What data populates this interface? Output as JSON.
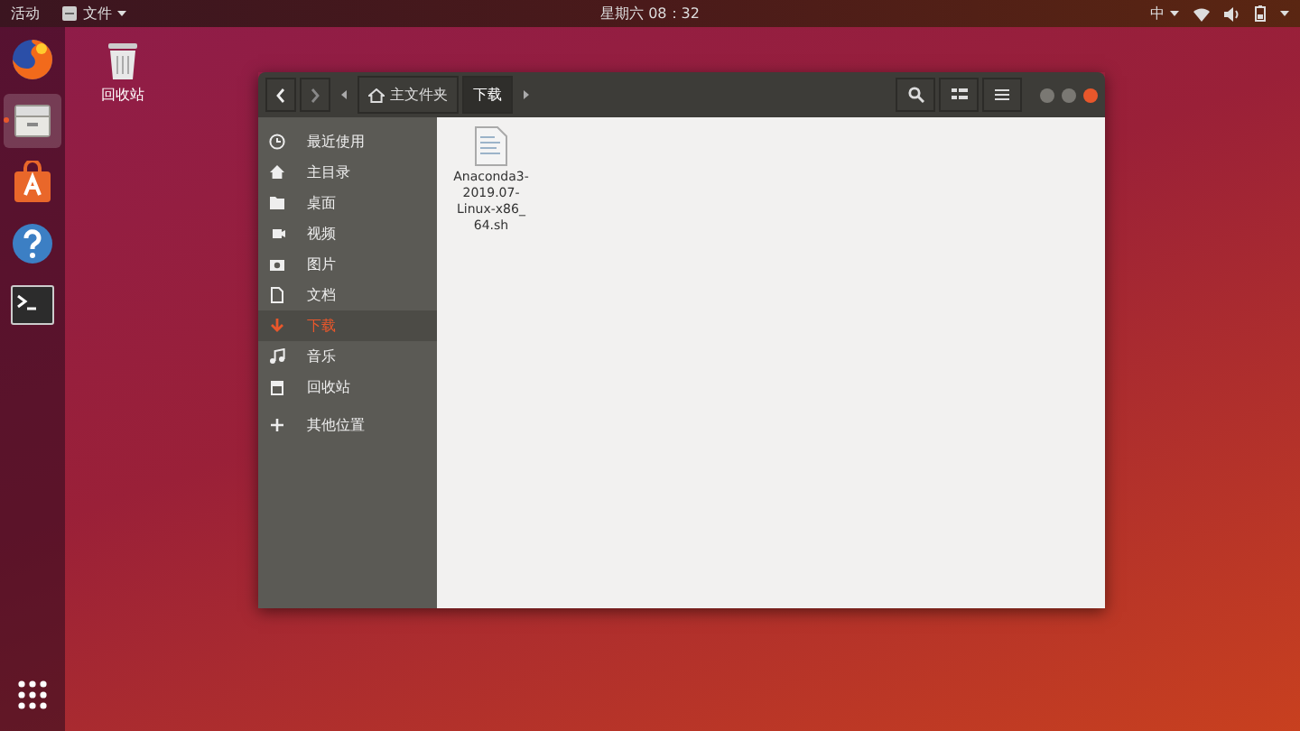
{
  "top_bar": {
    "activities": "活动",
    "app_menu": "文件",
    "clock": "星期六 08：32",
    "input_method": "中"
  },
  "dock": [
    {
      "kind": "browser",
      "selected": false
    },
    {
      "kind": "files",
      "selected": true
    },
    {
      "kind": "software",
      "selected": false
    },
    {
      "kind": "help",
      "selected": false
    },
    {
      "kind": "terminal",
      "selected": false
    }
  ],
  "desktop_icons": [
    {
      "label": "回收站"
    }
  ],
  "window": {
    "path": [
      {
        "label": "主文件夹",
        "kind": "home",
        "selected": false
      },
      {
        "label": "下载",
        "kind": "folder",
        "selected": true
      }
    ],
    "sidebar": [
      {
        "label": "最近使用",
        "kind": "recent",
        "selected": false
      },
      {
        "label": "主目录",
        "kind": "home",
        "selected": false
      },
      {
        "label": "桌面",
        "kind": "desktop",
        "selected": false
      },
      {
        "label": "视频",
        "kind": "video",
        "selected": false
      },
      {
        "label": "图片",
        "kind": "camera",
        "selected": false
      },
      {
        "label": "文档",
        "kind": "document",
        "selected": false
      },
      {
        "label": "下载",
        "kind": "download",
        "selected": true
      },
      {
        "label": "音乐",
        "kind": "music",
        "selected": false
      },
      {
        "label": "回收站",
        "kind": "trash",
        "selected": false
      },
      {
        "label": "其他位置",
        "kind": "other",
        "selected": false
      }
    ],
    "files": [
      {
        "name_lines": [
          "Anaconda3-",
          "2019.07-",
          "Linux-x86_",
          "64.sh"
        ]
      }
    ]
  }
}
